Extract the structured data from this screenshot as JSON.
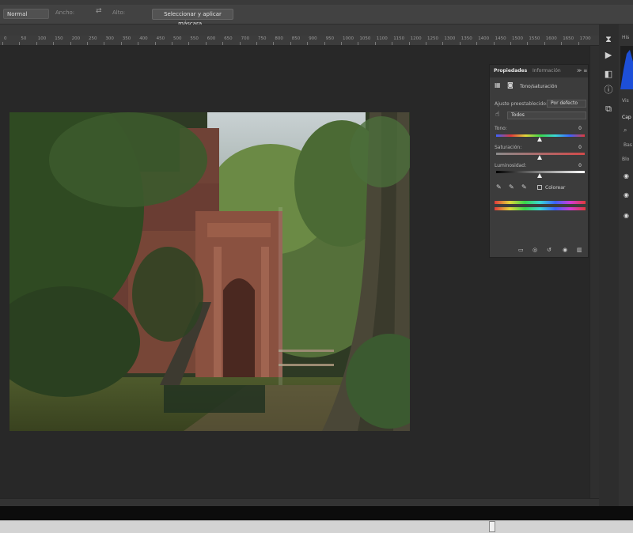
{
  "options_bar": {
    "mode_value": "Normal",
    "option_1": "Ancho:",
    "option_2": "Alto:",
    "select_mask_button": "Seleccionar y aplicar máscara..."
  },
  "ruler": {
    "labels": [
      "0",
      "50",
      "100",
      "150",
      "200",
      "250",
      "300",
      "350",
      "400",
      "450",
      "500",
      "550",
      "600",
      "650",
      "700",
      "750",
      "800",
      "850",
      "900",
      "950",
      "1000",
      "1050",
      "1100",
      "1150",
      "1200",
      "1250",
      "1300",
      "1350",
      "1400",
      "1450",
      "1500",
      "1550",
      "1600",
      "1650",
      "1700"
    ]
  },
  "properties_panel": {
    "tab_properties": "Propiedades",
    "tab_info": "Información",
    "adjustment_title": "Tono/saturación",
    "preset_label": "Ajuste preestablecido:",
    "preset_value": "Por defecto",
    "channel_value": "Todos",
    "hue_label": "Tono:",
    "hue_value": "0",
    "saturation_label": "Saturación:",
    "saturation_value": "0",
    "lightness_label": "Luminosidad:",
    "lightness_value": "0",
    "colorize_label": "Colorear"
  },
  "right_dock": {
    "histogram_label": "His",
    "layers_label": "Cap",
    "layer_filter": "Blo",
    "kind_label": "Bas"
  },
  "colors": {
    "panel_bg": "#3c3c3c",
    "app_bg": "#282828",
    "histogram_blue": "#1d4fd8"
  },
  "icons": {
    "eyedropper": "eyedropper-icon",
    "eye": "eye-icon",
    "trash": "trash-icon",
    "hand": "targeted-adjustment-icon"
  }
}
